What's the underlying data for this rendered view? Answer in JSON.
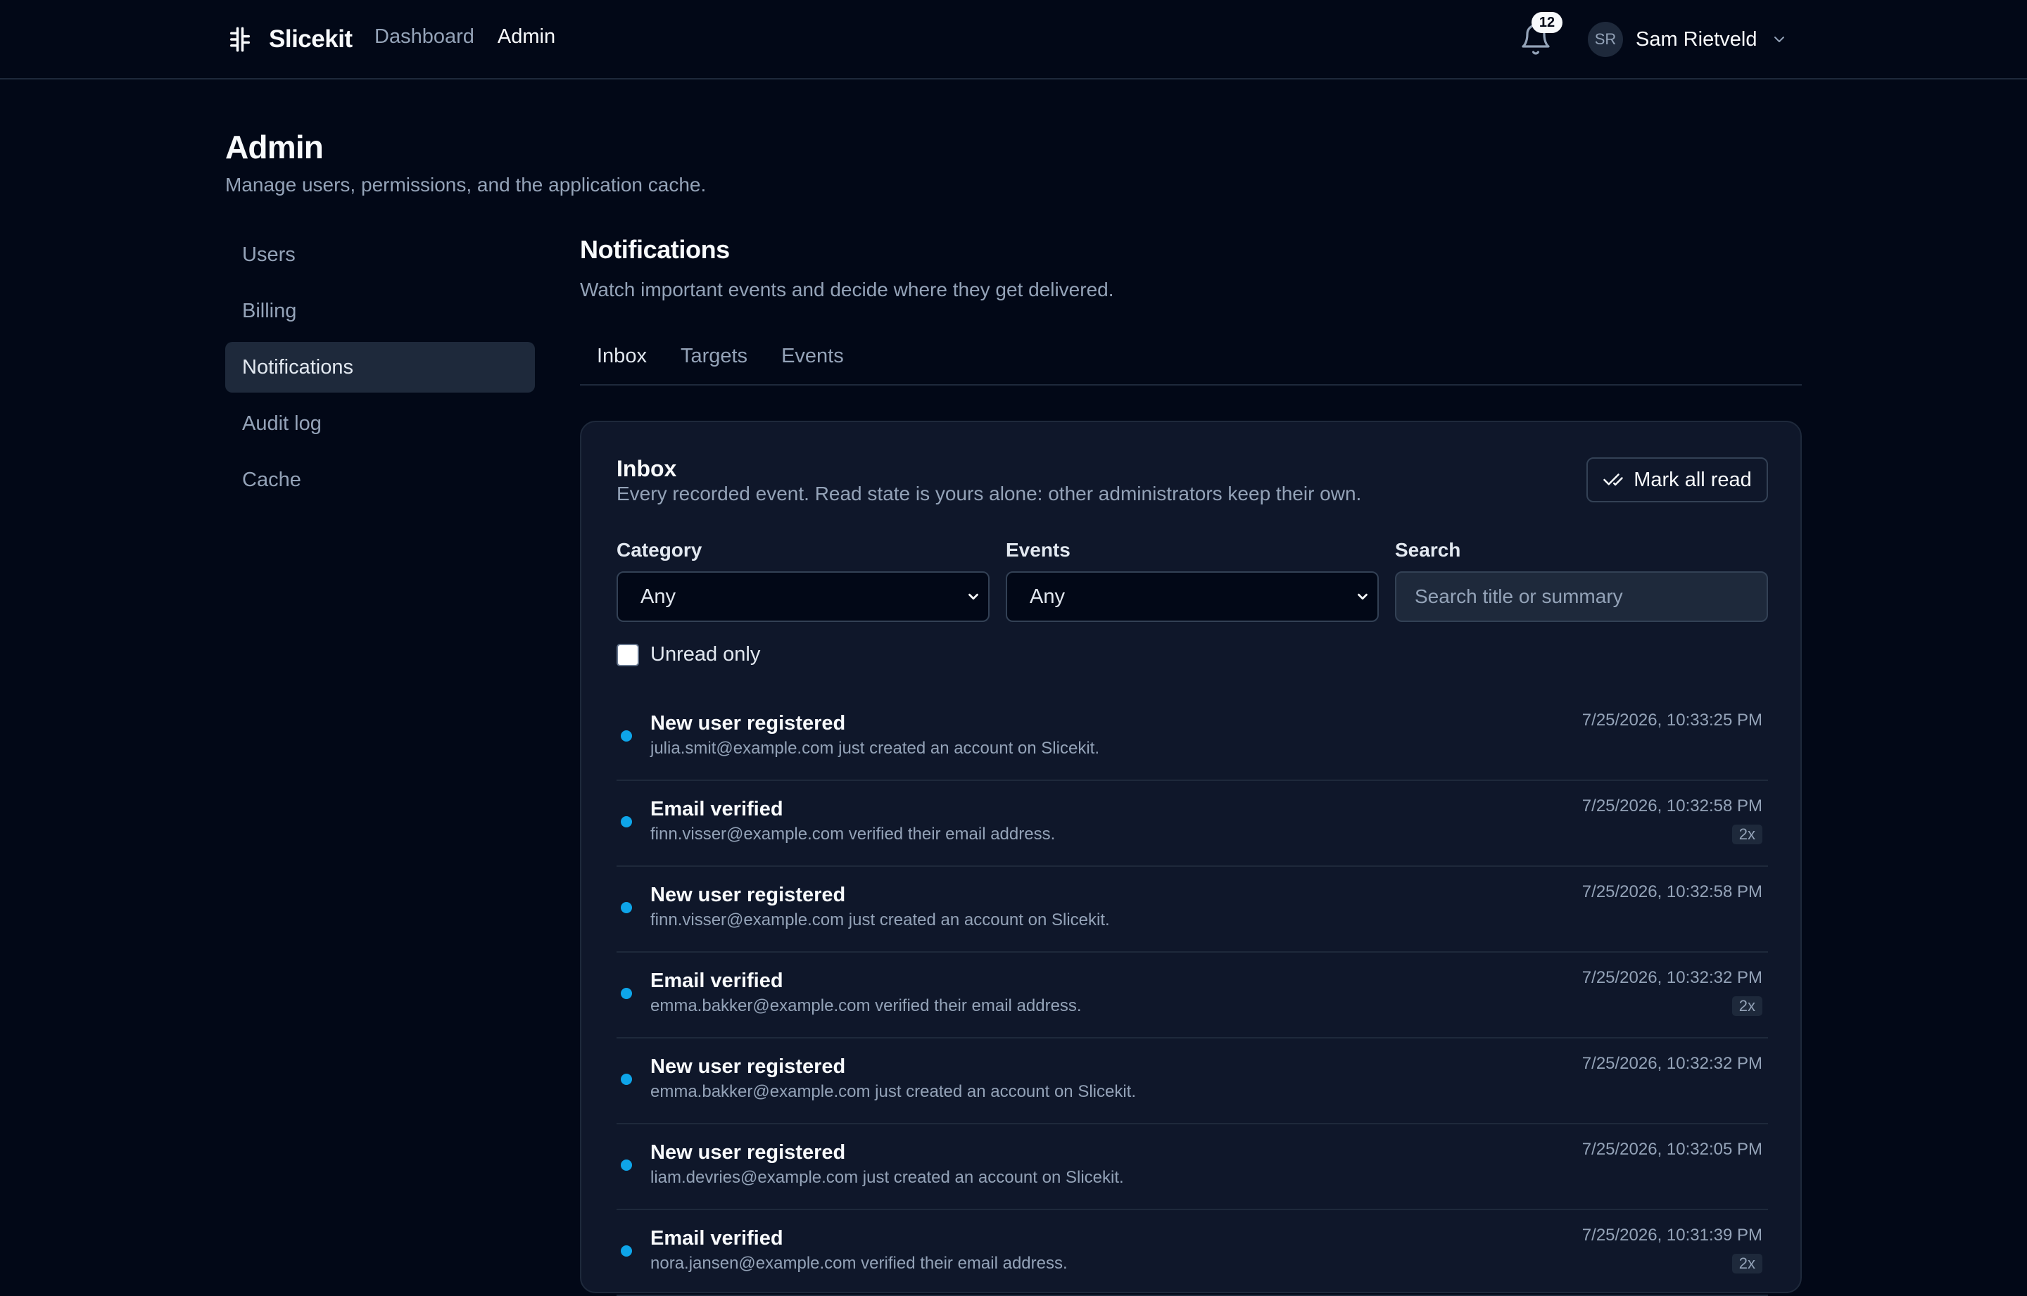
{
  "app": {
    "name": "Slicekit",
    "nav": [
      {
        "label": "Dashboard"
      },
      {
        "label": "Admin"
      }
    ],
    "notifications_count": "12",
    "user": {
      "initials": "SR",
      "name": "Sam Rietveld"
    }
  },
  "page": {
    "title": "Admin",
    "subtitle": "Manage users, permissions, and the application cache."
  },
  "sidebar": {
    "items": [
      {
        "label": "Users"
      },
      {
        "label": "Billing"
      },
      {
        "label": "Notifications"
      },
      {
        "label": "Audit log"
      },
      {
        "label": "Cache"
      }
    ]
  },
  "section": {
    "title": "Notifications",
    "subtitle": "Watch important events and decide where they get delivered.",
    "tabs": [
      {
        "label": "Inbox"
      },
      {
        "label": "Targets"
      },
      {
        "label": "Events"
      }
    ]
  },
  "inbox": {
    "title": "Inbox",
    "subtitle": "Every recorded event. Read state is yours alone: other administrators keep their own.",
    "mark_all_label": "Mark all read",
    "filters": {
      "category": {
        "label": "Category",
        "value": "Any"
      },
      "events": {
        "label": "Events",
        "value": "Any"
      },
      "search": {
        "label": "Search",
        "placeholder": "Search title or summary"
      }
    },
    "unread_only_label": "Unread only",
    "items": [
      {
        "title": "New user registered",
        "summary": "julia.smit@example.com just created an account on Slicekit.",
        "time": "7/25/2026, 10:33:25 PM",
        "count": ""
      },
      {
        "title": "Email verified",
        "summary": "finn.visser@example.com verified their email address.",
        "time": "7/25/2026, 10:32:58 PM",
        "count": "2x"
      },
      {
        "title": "New user registered",
        "summary": "finn.visser@example.com just created an account on Slicekit.",
        "time": "7/25/2026, 10:32:58 PM",
        "count": ""
      },
      {
        "title": "Email verified",
        "summary": "emma.bakker@example.com verified their email address.",
        "time": "7/25/2026, 10:32:32 PM",
        "count": "2x"
      },
      {
        "title": "New user registered",
        "summary": "emma.bakker@example.com just created an account on Slicekit.",
        "time": "7/25/2026, 10:32:32 PM",
        "count": ""
      },
      {
        "title": "New user registered",
        "summary": "liam.devries@example.com just created an account on Slicekit.",
        "time": "7/25/2026, 10:32:05 PM",
        "count": ""
      },
      {
        "title": "Email verified",
        "summary": "nora.jansen@example.com verified their email address.",
        "time": "7/25/2026, 10:31:39 PM",
        "count": "2x"
      }
    ]
  },
  "colors": {
    "background": "#020817",
    "card": "#0f172a",
    "unread_dot": "#0ea5e9",
    "muted_text": "#94a3b8"
  },
  "icons": {
    "logo": "slicekit-logo-icon",
    "bell": "bell-icon",
    "chevron": "chevron-down-icon",
    "mark_read": "check-check-icon"
  }
}
